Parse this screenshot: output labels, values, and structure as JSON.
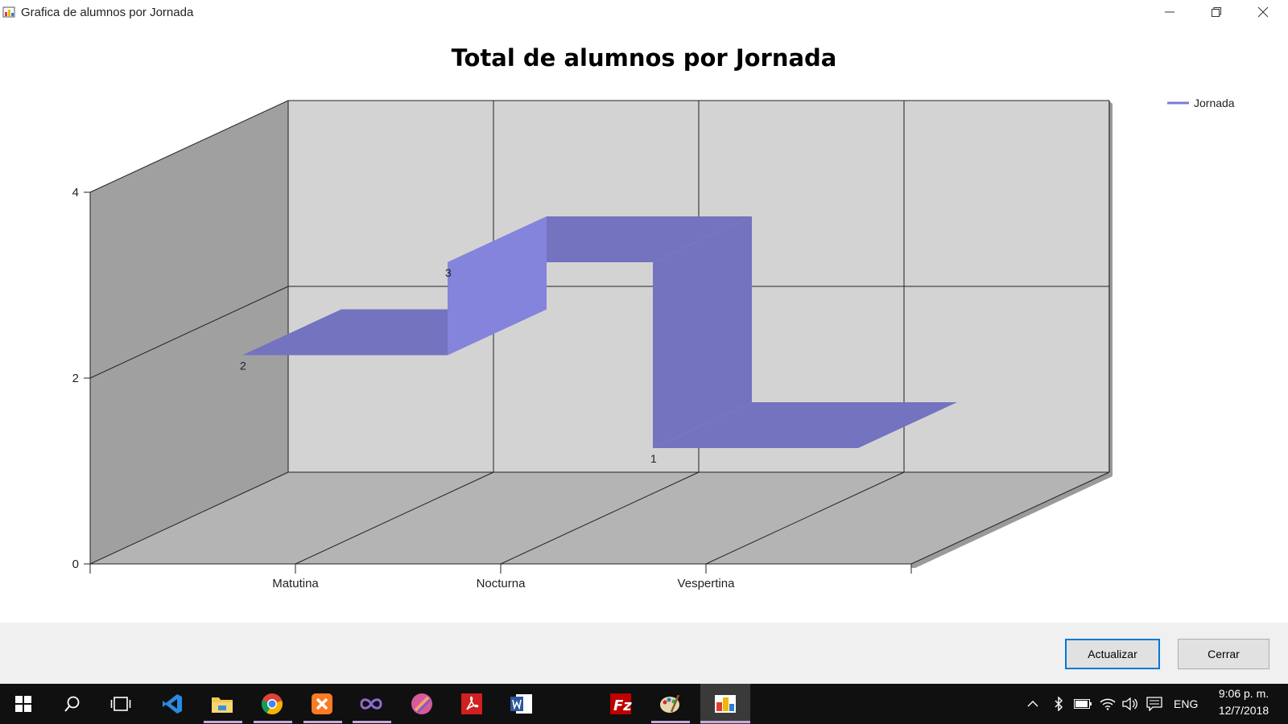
{
  "window": {
    "title": "Grafica de alumnos por Jornada",
    "minimize_icon": "minimize-icon",
    "restore_icon": "restore-icon",
    "close_icon": "close-icon"
  },
  "chart_data": {
    "type": "line",
    "style": "3d",
    "title": "Total de alumnos por Jornada",
    "categories": [
      "Matutina",
      "Nocturna",
      "Vespertina"
    ],
    "series": [
      {
        "name": "Jornada",
        "values": [
          2,
          3,
          1
        ],
        "color": "#7b7bd6"
      }
    ],
    "data_labels": [
      "2",
      "3",
      "1"
    ],
    "y_ticks": [
      "0",
      "2",
      "4"
    ],
    "ylim": [
      0,
      4
    ],
    "grid": true,
    "legend": "top-right"
  },
  "footer": {
    "refresh_label": "Actualizar",
    "close_label": "Cerrar"
  },
  "taskbar": {
    "apps": [
      "windows-start-icon",
      "search-icon",
      "task-view-icon",
      "vscode-icon",
      "file-explorer-icon",
      "chrome-icon",
      "xampp-icon",
      "visual-studio-icon",
      "app-icon",
      "acrobat-icon",
      "word-icon",
      "filezilla-icon",
      "paint-icon",
      "chart-app-icon"
    ],
    "language": "ENG",
    "time": "9:06 p. m.",
    "date": "12/7/2018"
  }
}
